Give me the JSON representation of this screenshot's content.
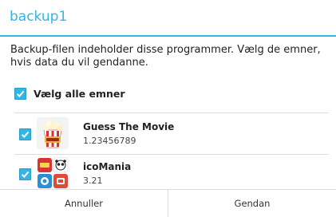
{
  "dialog": {
    "title": "backup1",
    "message": "Backup-filen indeholder disse programmer. Vælg de emner, hvis data du vil gendanne.",
    "select_all": {
      "label": "Vælg alle emner",
      "checked": true
    }
  },
  "apps": [
    {
      "name": "Guess The Movie",
      "version": "1.23456789",
      "checked": true,
      "icon": "guess-the-movie-app-icon"
    },
    {
      "name": "icoMania",
      "version": "3.21",
      "checked": true,
      "icon": "icomania-app-icon"
    }
  ],
  "buttons": {
    "cancel": "Annuller",
    "restore": "Gendan"
  },
  "colors": {
    "accent": "#33b5e5",
    "divider": "#dddddd"
  }
}
